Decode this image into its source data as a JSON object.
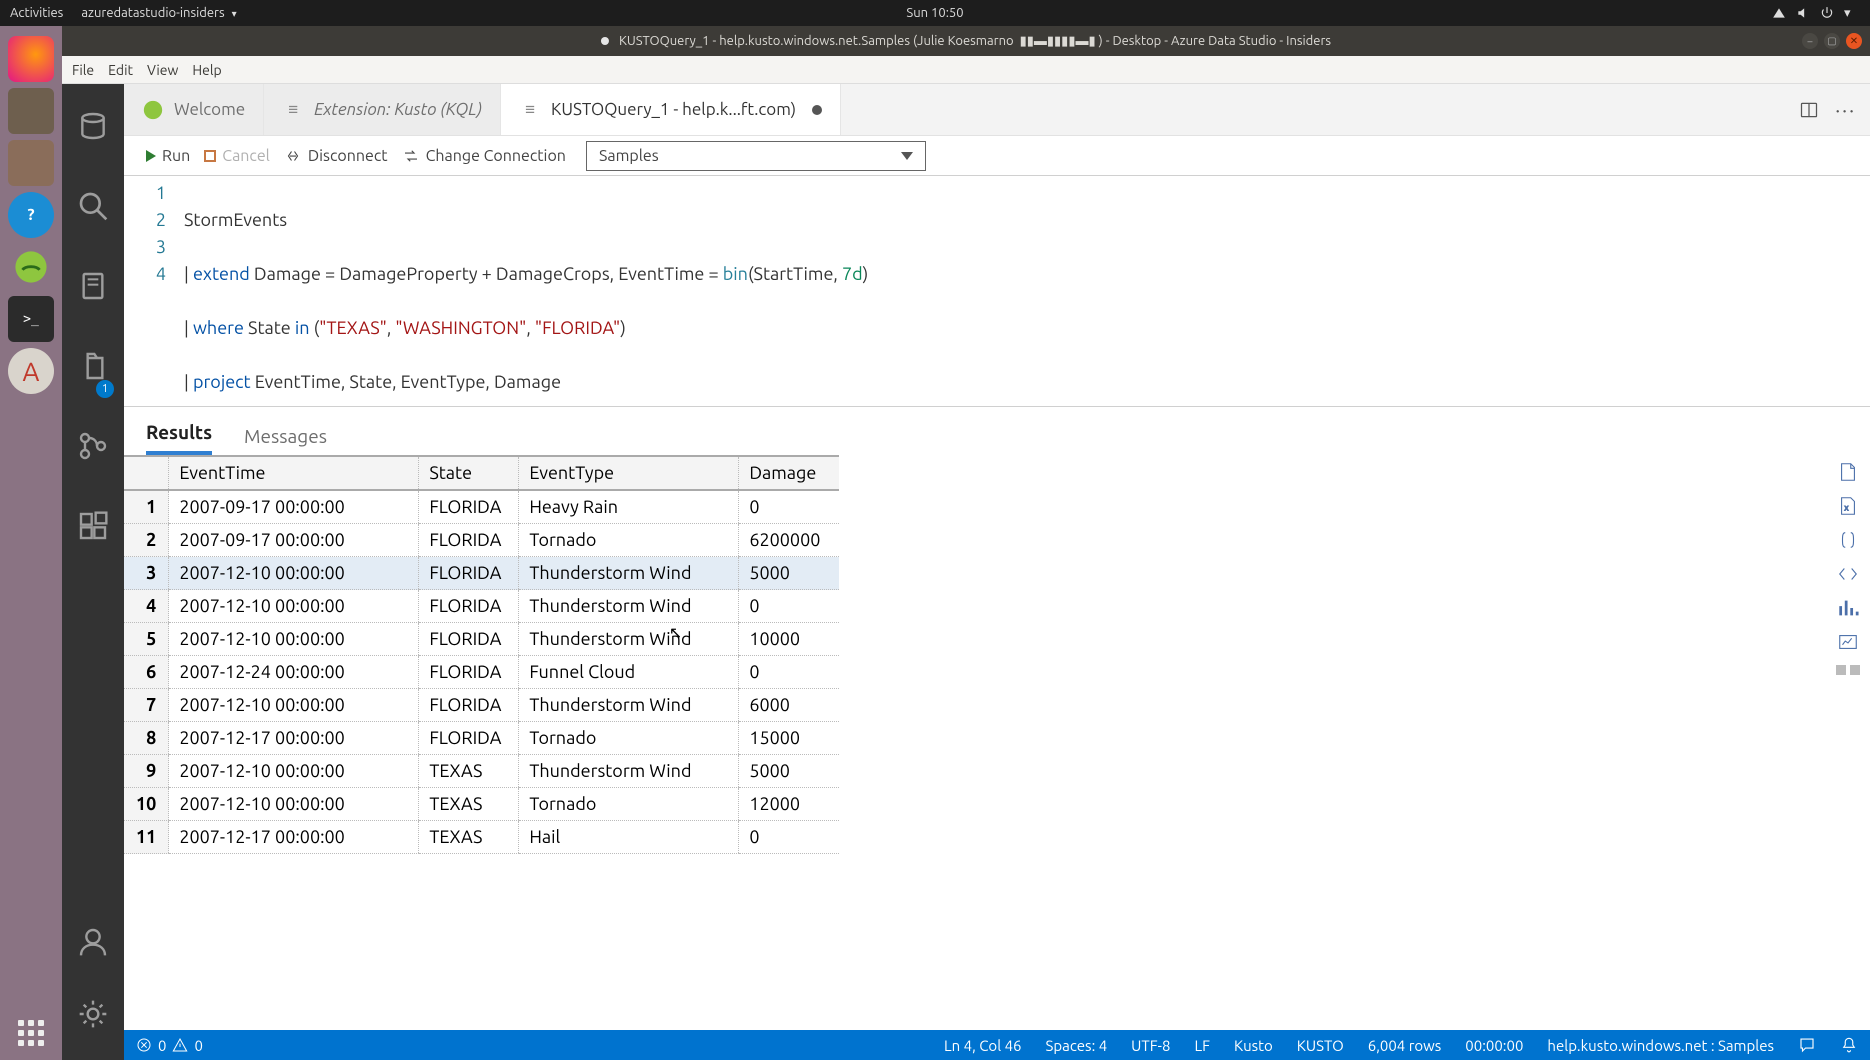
{
  "gnome": {
    "activities": "Activities",
    "app": "azuredatastudio-insiders",
    "clock": "Sun 10:50"
  },
  "titlebar": {
    "full": "KUSTOQuery_1 - help.kusto.windows.net.Samples (Julie Koesmarno",
    "suffix": ") - Desktop - Azure Data Studio - Insiders"
  },
  "menu": {
    "file": "File",
    "edit": "Edit",
    "view": "View",
    "help": "Help"
  },
  "activitybar": {
    "scm_badge": "1"
  },
  "tabs": {
    "welcome": "Welcome",
    "extension": "Extension: Kusto (KQL)",
    "active": "KUSTOQuery_1 - help.k...ft.com)"
  },
  "toolbar": {
    "run": "Run",
    "cancel": "Cancel",
    "disconnect": "Disconnect",
    "change_conn": "Change Connection",
    "db": "Samples"
  },
  "code": {
    "l1": "1",
    "l2": "2",
    "l3": "3",
    "l4": "4",
    "line1": "StormEvents",
    "line2_a": "| ",
    "line2_extend": "extend",
    "line2_b": " Damage = DamageProperty + DamageCrops, EventTime = ",
    "line2_bin": "bin",
    "line2_c": "(StartTime, ",
    "line2_dur": "7d",
    "line2_d": ")",
    "line3_a": "| ",
    "line3_where": "where",
    "line3_b": " State ",
    "line3_in": "in",
    "line3_c": " (",
    "line3_s1": "\"TEXAS\"",
    "line3_d": ", ",
    "line3_s2": "\"WASHINGTON\"",
    "line3_e": ", ",
    "line3_s3": "\"FLORIDA\"",
    "line3_f": ")",
    "line4_a": "| ",
    "line4_project": "project",
    "line4_b": " EventTime, State, EventType, Damage"
  },
  "results_tabs": {
    "results": "Results",
    "messages": "Messages"
  },
  "columns": {
    "c0": "",
    "c1": "EventTime",
    "c2": "State",
    "c3": "EventType",
    "c4": "Damage"
  },
  "rows": [
    {
      "n": "1",
      "t": "2007-09-17 00:00:00",
      "s": "FLORIDA",
      "e": "Heavy Rain",
      "d": "0"
    },
    {
      "n": "2",
      "t": "2007-09-17 00:00:00",
      "s": "FLORIDA",
      "e": "Tornado",
      "d": "6200000"
    },
    {
      "n": "3",
      "t": "2007-12-10 00:00:00",
      "s": "FLORIDA",
      "e": "Thunderstorm Wind",
      "d": "5000"
    },
    {
      "n": "4",
      "t": "2007-12-10 00:00:00",
      "s": "FLORIDA",
      "e": "Thunderstorm Wind",
      "d": "0"
    },
    {
      "n": "5",
      "t": "2007-12-10 00:00:00",
      "s": "FLORIDA",
      "e": "Thunderstorm Wind",
      "d": "10000"
    },
    {
      "n": "6",
      "t": "2007-12-24 00:00:00",
      "s": "FLORIDA",
      "e": "Funnel Cloud",
      "d": "0"
    },
    {
      "n": "7",
      "t": "2007-12-10 00:00:00",
      "s": "FLORIDA",
      "e": "Thunderstorm Wind",
      "d": "6000"
    },
    {
      "n": "8",
      "t": "2007-12-17 00:00:00",
      "s": "FLORIDA",
      "e": "Tornado",
      "d": "15000"
    },
    {
      "n": "9",
      "t": "2007-12-10 00:00:00",
      "s": "TEXAS",
      "e": "Thunderstorm Wind",
      "d": "5000"
    },
    {
      "n": "10",
      "t": "2007-12-10 00:00:00",
      "s": "TEXAS",
      "e": "Tornado",
      "d": "12000"
    },
    {
      "n": "11",
      "t": "2007-12-17 00:00:00",
      "s": "TEXAS",
      "e": "Hail",
      "d": "0"
    }
  ],
  "status": {
    "err": "0",
    "warn": "0",
    "pos": "Ln 4, Col 46",
    "spaces": "Spaces: 4",
    "enc": "UTF-8",
    "eol": "LF",
    "lang": "Kusto",
    "conn": "KUSTO",
    "rows": "6,004 rows",
    "elapsed": "00:00:00",
    "server": "help.kusto.windows.net : Samples"
  }
}
